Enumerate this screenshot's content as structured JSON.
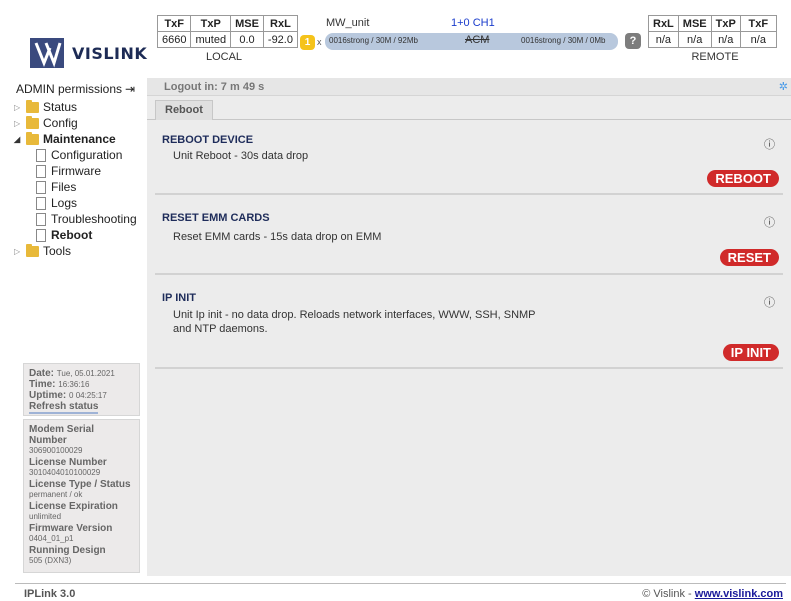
{
  "brand": {
    "name": "VISLINK"
  },
  "local": {
    "headers": [
      "TxF",
      "TxP",
      "MSE",
      "RxL"
    ],
    "values": [
      "6660",
      "muted",
      "0.0",
      "-92.0"
    ],
    "caption": "LOCAL"
  },
  "remote": {
    "headers": [
      "RxL",
      "MSE",
      "TxP",
      "TxF"
    ],
    "values": [
      "n/a",
      "n/a",
      "n/a",
      "n/a"
    ],
    "caption": "REMOTE"
  },
  "mw": {
    "label": "MW_unit",
    "channel": "1+0 CH1",
    "count": "1",
    "multiplier": "x",
    "left_mode": "0016strong / 30M / 92Mb",
    "acm": "ACM",
    "right_mode": "0016strong / 30M / 0Mb",
    "help": "?"
  },
  "sidebar": {
    "admin_label": "ADMIN permissions",
    "tree": {
      "status": "Status",
      "config": "Config",
      "maintenance": "Maintenance",
      "children": [
        "Configuration",
        "Firmware",
        "Files",
        "Logs",
        "Troubleshooting",
        "Reboot"
      ],
      "tools": "Tools"
    },
    "status_panel": {
      "date_label": "Date:",
      "date_value": "Tue, 05.01.2021",
      "time_label": "Time:",
      "time_value": "16:36:16",
      "uptime_label": "Uptime:",
      "uptime_value": "0 04:25:17",
      "refresh": "Refresh status"
    },
    "info_panel": [
      {
        "label": "Modem Serial Number",
        "value": "306900100029"
      },
      {
        "label": "License Number",
        "value": "3010404010100029"
      },
      {
        "label": "License Type / Status",
        "value": "permanent / ok"
      },
      {
        "label": "License Expiration",
        "value": "unlimited"
      },
      {
        "label": "Firmware Version",
        "value": "0404_01_p1"
      },
      {
        "label": "Running Design",
        "value": "505 (DXN3)"
      }
    ]
  },
  "main": {
    "logout": "Logout in: 7 m 49 s",
    "tab": "Reboot",
    "sections": [
      {
        "title": "REBOOT DEVICE",
        "desc": "Unit Reboot - 30s data drop",
        "button": "REBOOT"
      },
      {
        "title": "RESET EMM CARDS",
        "desc": "Reset EMM cards - 15s data drop on EMM",
        "button": "RESET"
      },
      {
        "title": "IP INIT",
        "desc": "Unit Ip init - no data drop. Reloads network interfaces, WWW, SSH, SNMP and NTP daemons.",
        "button": "IP INIT"
      }
    ]
  },
  "footer": {
    "version": "IPLink 3.0",
    "copyright": "© Vislink - ",
    "link": "www.vislink.com"
  },
  "colors": {
    "accent_red": "#d02a2a",
    "title_blue": "#1e2c5a",
    "folder": "#e8b93a"
  }
}
